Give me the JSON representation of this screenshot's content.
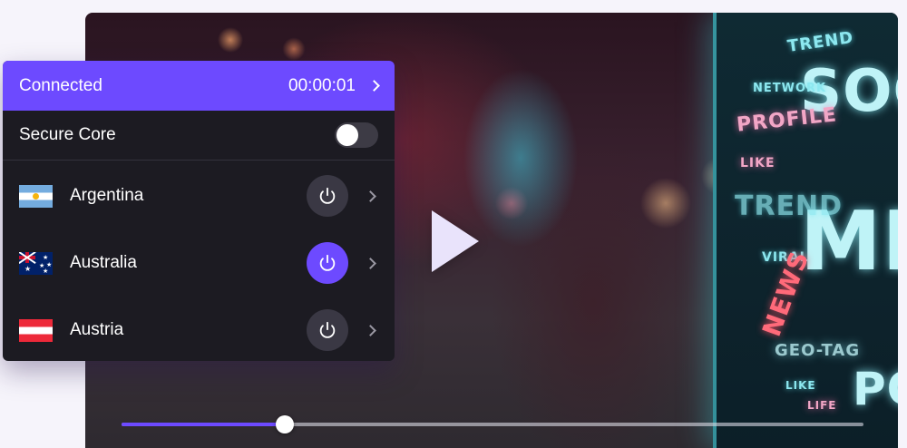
{
  "vpn": {
    "header": {
      "status": "Connected",
      "timer": "00:00:01"
    },
    "secure_core": {
      "label": "Secure Core",
      "enabled": false
    },
    "countries": [
      {
        "name": "Argentina",
        "flag": "argentina-flag-icon",
        "connected": false
      },
      {
        "name": "Australia",
        "flag": "australia-flag-icon",
        "connected": true
      },
      {
        "name": "Austria",
        "flag": "austria-flag-icon",
        "connected": false
      }
    ]
  },
  "video": {
    "progress": 0.22,
    "billboard_words": [
      "TREND",
      "SOC",
      "ME",
      "NETWORK",
      "PROFILE",
      "LIKE",
      "TREND",
      "VIRAL",
      "NEWS",
      "GEO-TAG",
      "LIKE",
      "PO",
      "LIFE"
    ]
  },
  "colors": {
    "accent": "#6d4aff",
    "panel_bg": "#1c1b22",
    "button_bg": "#3a3844"
  }
}
